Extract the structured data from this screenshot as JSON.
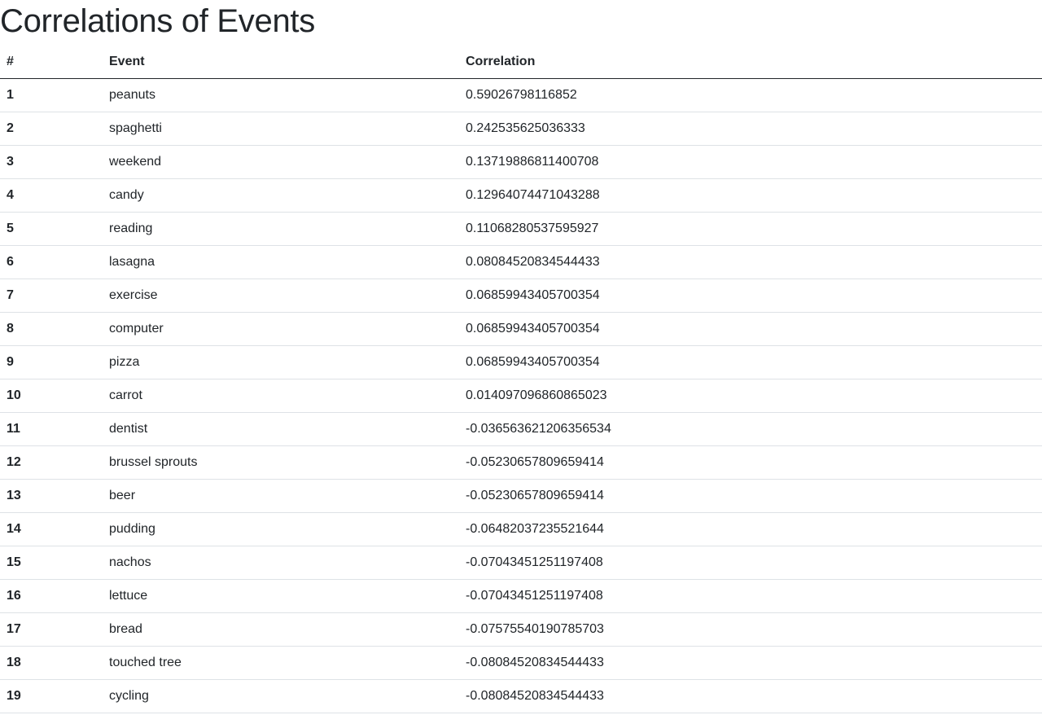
{
  "page": {
    "title": "Correlations of Events"
  },
  "table": {
    "headers": {
      "rank": "#",
      "event": "Event",
      "correlation": "Correlation"
    },
    "rows": [
      {
        "rank": "1",
        "event": "peanuts",
        "correlation": "0.59026798116852"
      },
      {
        "rank": "2",
        "event": "spaghetti",
        "correlation": "0.242535625036333"
      },
      {
        "rank": "3",
        "event": "weekend",
        "correlation": "0.13719886811400708"
      },
      {
        "rank": "4",
        "event": "candy",
        "correlation": "0.12964074471043288"
      },
      {
        "rank": "5",
        "event": "reading",
        "correlation": "0.11068280537595927"
      },
      {
        "rank": "6",
        "event": "lasagna",
        "correlation": "0.08084520834544433"
      },
      {
        "rank": "7",
        "event": "exercise",
        "correlation": "0.06859943405700354"
      },
      {
        "rank": "8",
        "event": "computer",
        "correlation": "0.06859943405700354"
      },
      {
        "rank": "9",
        "event": "pizza",
        "correlation": "0.06859943405700354"
      },
      {
        "rank": "10",
        "event": "carrot",
        "correlation": "0.014097096860865023"
      },
      {
        "rank": "11",
        "event": "dentist",
        "correlation": "-0.036563621206356534"
      },
      {
        "rank": "12",
        "event": "brussel sprouts",
        "correlation": "-0.05230657809659414"
      },
      {
        "rank": "13",
        "event": "beer",
        "correlation": "-0.05230657809659414"
      },
      {
        "rank": "14",
        "event": "pudding",
        "correlation": "-0.06482037235521644"
      },
      {
        "rank": "15",
        "event": "nachos",
        "correlation": "-0.07043451251197408"
      },
      {
        "rank": "16",
        "event": "lettuce",
        "correlation": "-0.07043451251197408"
      },
      {
        "rank": "17",
        "event": "bread",
        "correlation": "-0.07575540190785703"
      },
      {
        "rank": "18",
        "event": "touched tree",
        "correlation": "-0.08084520834544433"
      },
      {
        "rank": "19",
        "event": "cycling",
        "correlation": "-0.08084520834544433"
      }
    ]
  }
}
